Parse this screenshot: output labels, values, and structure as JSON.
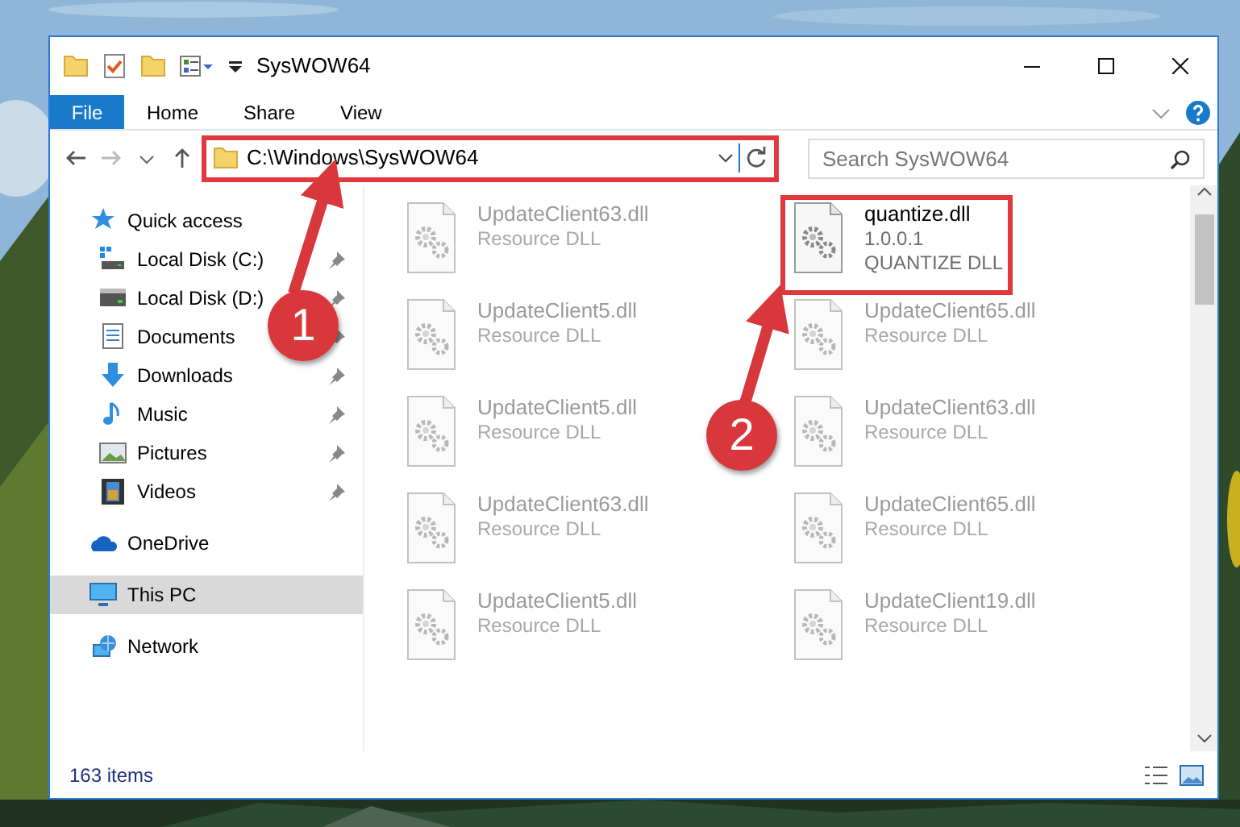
{
  "window": {
    "title": "SysWOW64"
  },
  "ribbon_tabs": [
    {
      "label": "File",
      "kind": "file",
      "selected": false
    },
    {
      "label": "Home",
      "kind": "tab",
      "selected": false
    },
    {
      "label": "Share",
      "kind": "tab",
      "selected": false
    },
    {
      "label": "View",
      "kind": "tab",
      "selected": false
    }
  ],
  "address": {
    "path": "C:\\Windows\\SysWOW64"
  },
  "search": {
    "placeholder": "Search SysWOW64"
  },
  "sidebar": {
    "items": [
      {
        "label": "Quick access",
        "kind": "star",
        "selected": false,
        "children": [
          {
            "label": "Local Disk (C:)",
            "kind": "systemdrive",
            "pinned": true
          },
          {
            "label": "Local Disk (D:)",
            "kind": "drive",
            "pinned": true
          },
          {
            "label": "Documents",
            "kind": "documents",
            "pinned": true
          },
          {
            "label": "Downloads",
            "kind": "downloads",
            "pinned": true
          },
          {
            "label": "Music",
            "kind": "music",
            "pinned": true
          },
          {
            "label": "Pictures",
            "kind": "pictures",
            "pinned": true
          },
          {
            "label": "Videos",
            "kind": "videos",
            "pinned": true
          }
        ]
      },
      {
        "label": "OneDrive",
        "kind": "cloud",
        "selected": false
      },
      {
        "label": "This PC",
        "kind": "pc",
        "selected": true
      },
      {
        "label": "Network",
        "kind": "network",
        "selected": false
      }
    ]
  },
  "files": [
    {
      "name": "UpdateClient63.dll",
      "description": "Resource DLL",
      "blurred": true,
      "highlighted": false
    },
    {
      "name": "quantize.dll",
      "version": "1.0.0.1",
      "description": "QUANTIZE DLL",
      "blurred": false,
      "highlighted": true
    },
    {
      "name": "UpdateClient5.dll",
      "description": "Resource DLL",
      "blurred": true,
      "highlighted": false
    },
    {
      "name": "UpdateClient65.dll",
      "description": "Resource DLL",
      "blurred": true,
      "highlighted": false
    },
    {
      "name": "UpdateClient5.dll",
      "description": "Resource DLL",
      "blurred": true,
      "highlighted": false
    },
    {
      "name": "UpdateClient63.dll",
      "description": "Resource DLL",
      "blurred": true,
      "highlighted": false
    },
    {
      "name": "UpdateClient63.dll",
      "description": "Resource DLL",
      "blurred": true,
      "highlighted": false
    },
    {
      "name": "UpdateClient65.dll",
      "description": "Resource DLL",
      "blurred": true,
      "highlighted": false
    },
    {
      "name": "UpdateClient5.dll",
      "description": "Resource DLL",
      "blurred": true,
      "highlighted": false
    },
    {
      "name": "UpdateClient19.dll",
      "description": "Resource DLL",
      "blurred": true,
      "highlighted": false
    }
  ],
  "status_bar": {
    "item_count": "163 items"
  },
  "annotations": [
    {
      "label": "1"
    },
    {
      "label": "2"
    }
  ]
}
